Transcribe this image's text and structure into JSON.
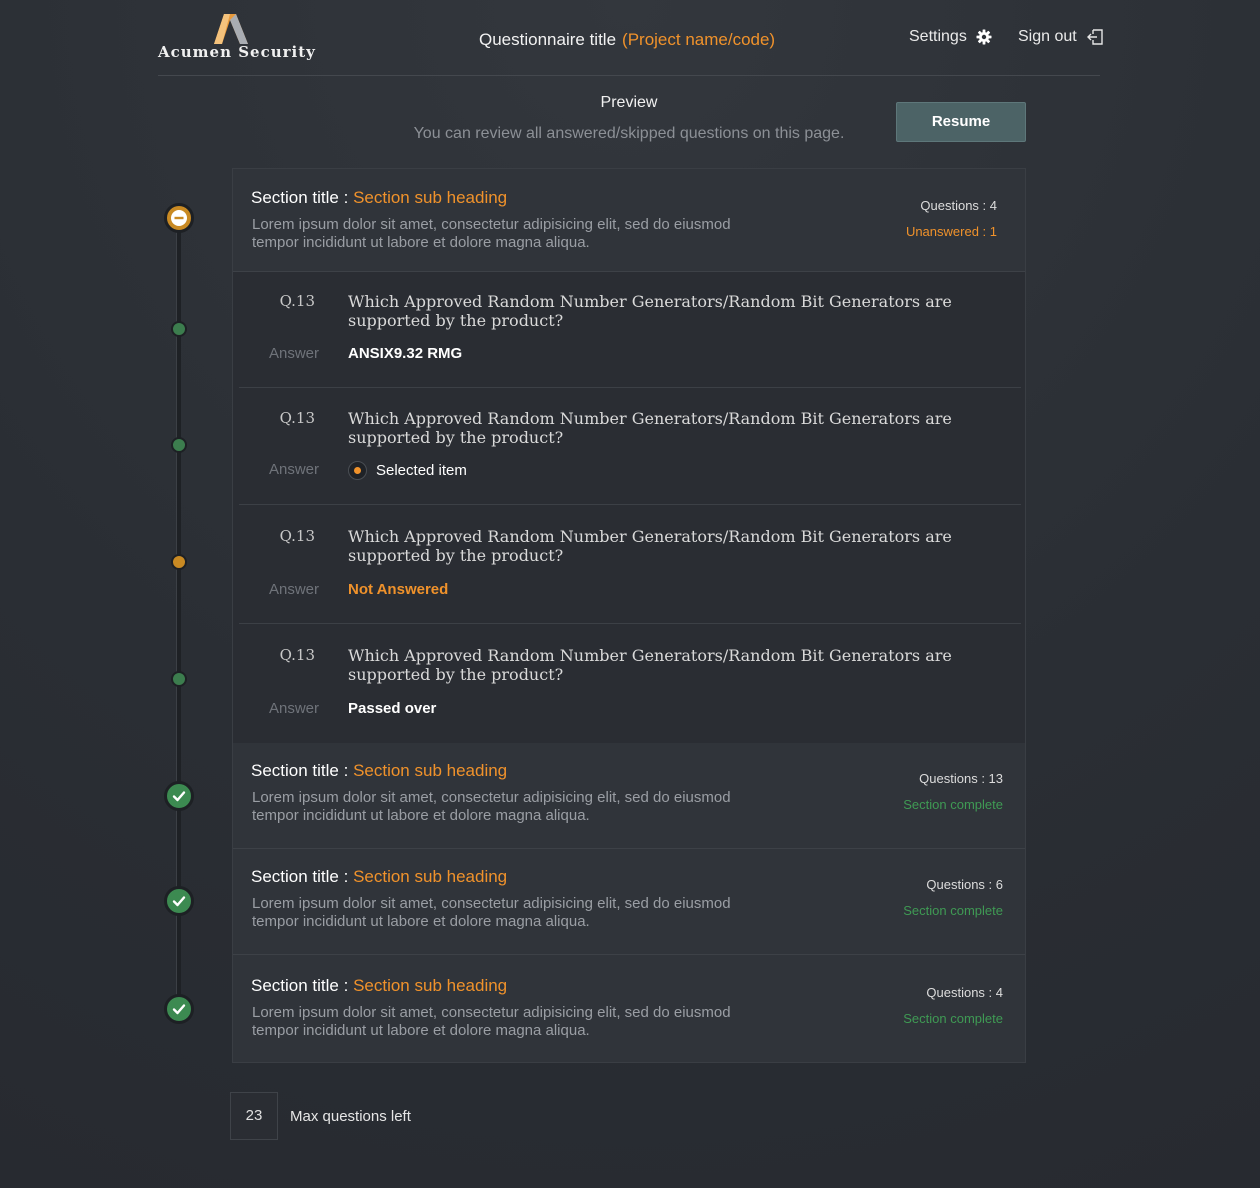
{
  "header": {
    "logo_text": "Acumen Security",
    "questionnaire_title": "Questionnaire title",
    "project_name": "(Project name/code)",
    "settings_label": "Settings",
    "signout_label": "Sign out"
  },
  "preview": {
    "title": "Preview",
    "subtitle": "You can review all answered/skipped questions on this page.",
    "resume_label": "Resume"
  },
  "sections": [
    {
      "title_prefix": "Section title : ",
      "sub_heading": "Section sub heading",
      "description": "Lorem ipsum dolor sit amet, consectetur adipisicing elit, sed do eiusmod tempor incididunt ut labore et dolore magna aliqua.",
      "questions_count": "Questions : 4",
      "status": "Unanswered : 1",
      "status_color": "#f0922b"
    },
    {
      "title_prefix": "Section title : ",
      "sub_heading": "Section sub heading",
      "description": "Lorem ipsum dolor sit amet, consectetur adipisicing elit, sed do eiusmod tempor incididunt ut labore et dolore magna aliqua.",
      "questions_count": "Questions : 13",
      "status": "Section complete",
      "status_color": "#3f9a54"
    },
    {
      "title_prefix": "Section title : ",
      "sub_heading": "Section sub heading",
      "description": "Lorem ipsum dolor sit amet, consectetur adipisicing elit, sed do eiusmod tempor incididunt ut labore et dolore magna aliqua.",
      "questions_count": "Questions : 6",
      "status": "Section complete",
      "status_color": "#3f9a54"
    },
    {
      "title_prefix": "Section title : ",
      "sub_heading": "Section sub heading",
      "description": "Lorem ipsum dolor sit amet, consectetur adipisicing elit, sed do eiusmod tempor incididunt ut labore et dolore magna aliqua.",
      "questions_count": "Questions : 4",
      "status": "Section complete",
      "status_color": "#3f9a54"
    }
  ],
  "questions": [
    {
      "number": "Q.13",
      "text": "Which Approved Random Number Generators/Random Bit Generators are supported by the product?",
      "answer_label": "Answer",
      "answer": "ANSIX9.32 RMG"
    },
    {
      "number": "Q.13",
      "text": "Which Approved Random Number Generators/Random Bit Generators are supported by the product?",
      "answer_label": "Answer",
      "answer": "Selected item"
    },
    {
      "number": "Q.13",
      "text": "Which Approved Random Number Generators/Random Bit Generators are supported by the product?",
      "answer_label": "Answer",
      "answer": "Not Answered"
    },
    {
      "number": "Q.13",
      "text": "Which Approved Random Number Generators/Random Bit Generators are supported by the product?",
      "answer_label": "Answer",
      "answer": "Passed over"
    }
  ],
  "footer": {
    "count": "23",
    "label": "Max questions left"
  },
  "colors": {
    "accent_orange": "#f0922b",
    "complete_green": "#3f9a54",
    "resume_button": "#4c6366"
  },
  "icons": {
    "settings": "gear-icon",
    "signout": "sign-out-icon",
    "section_in_progress": "minus-circle-icon",
    "section_complete": "check-circle-icon"
  }
}
